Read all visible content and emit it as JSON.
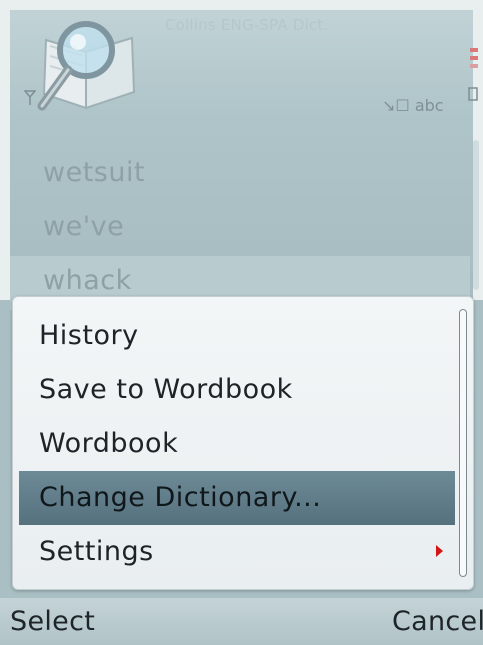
{
  "app": {
    "title": "Collins ENG-SPA Dict.",
    "input_indicator": "↘☐ abc"
  },
  "icons": {
    "app_icon": "dictionary-magnifier-icon",
    "signal": "signal-icon",
    "battery": "battery-icon"
  },
  "word_list": {
    "items": [
      {
        "label": "wetsuit"
      },
      {
        "label": "we've"
      },
      {
        "label": "whack"
      }
    ],
    "selected_index": 2
  },
  "options_menu": {
    "items": [
      {
        "label": "History"
      },
      {
        "label": "Save to Wordbook"
      },
      {
        "label": "Wordbook"
      },
      {
        "label": "Change Dictionary..."
      },
      {
        "label": "Settings",
        "has_submenu": true
      }
    ],
    "highlighted_index": 3
  },
  "softkeys": {
    "left": "Select",
    "right": "Cancel"
  },
  "colors": {
    "highlight": "#5f7b88",
    "submenu_arrow": "#d01616"
  }
}
